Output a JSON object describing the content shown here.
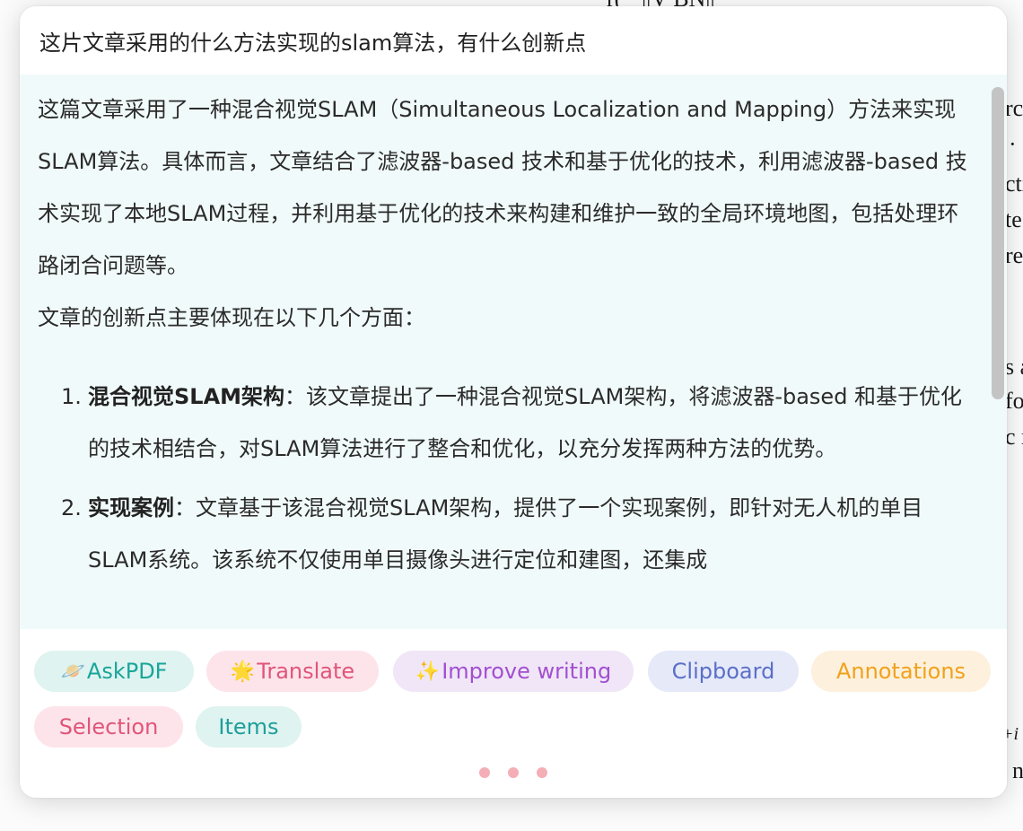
{
  "background": {
    "fragments": [
      "r(  ·  ||V     BN||",
      "rcl",
      "·",
      "cti",
      "te",
      "re",
      "s a",
      "fo",
      "c r",
      "+i",
      "n"
    ]
  },
  "question": "这片文章采用的什么方法实现的slam算法，有什么创新点",
  "answer": {
    "intro": "这篇文章采用了一种混合视觉SLAM（Simultaneous Localization and Mapping）方法来实现SLAM算法。具体而言，文章结合了滤波器-based 技术和基于优化的技术，利用滤波器-based 技术实现了本地SLAM过程，并利用基于优化的技术来构建和维护一致的全局环境地图，包括处理环路闭合问题等。",
    "lead": "文章的创新点主要体现在以下几个方面：",
    "items": [
      {
        "num": "1.",
        "head": "混合视觉SLAM架构",
        "body": "：该文章提出了一种混合视觉SLAM架构，将滤波器-based 和基于优化的技术相结合，对SLAM算法进行了整合和优化，以充分发挥两种方法的优势。"
      },
      {
        "num": "2.",
        "head": "实现案例",
        "body": "：文章基于该混合视觉SLAM架构，提供了一个实现案例，即针对无人机的单目SLAM系统。该系统不仅使用单目摄像头进行定位和建图，还集成"
      }
    ]
  },
  "actions": [
    {
      "icon": "🪐",
      "icon_name": "planet-icon",
      "label": "AskPDF",
      "color": "#1aa59a",
      "bg": "#dff3f0"
    },
    {
      "icon": "🌟",
      "icon_name": "star-icon",
      "label": "Translate",
      "color": "#e0557a",
      "bg": "#fde4ea"
    },
    {
      "icon": "✨",
      "icon_name": "sparkles-icon",
      "label": "Improve writing",
      "color": "#a24fd0",
      "bg": "#f0e6f7"
    },
    {
      "icon": "",
      "icon_name": "",
      "label": "Clipboard",
      "color": "#5a6fc8",
      "bg": "#e5e9f8"
    },
    {
      "icon": "",
      "icon_name": "",
      "label": "Annotations",
      "color": "#f0a21c",
      "bg": "#fdf0dc"
    },
    {
      "icon": "",
      "icon_name": "",
      "label": "Selection",
      "color": "#e0557a",
      "bg": "#fde4ea"
    },
    {
      "icon": "",
      "icon_name": "",
      "label": "Items",
      "color": "#1f9e9a",
      "bg": "#dff3f0"
    }
  ],
  "colors": {
    "answer_bg": "#f1fafa",
    "dot": "#f4aeb6"
  }
}
